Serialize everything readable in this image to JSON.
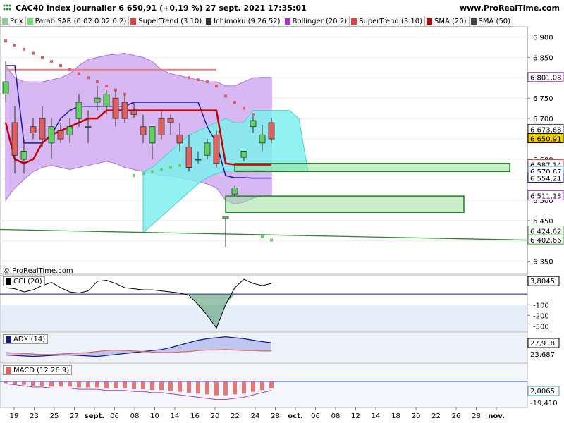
{
  "header": {
    "title": "CAC40 Index Journalier 6 650,91 (+0,19 %) 27 sept. 2021 17:35:01",
    "site": "www.ProRealTime.com",
    "copyright": "© ProRealTime.com"
  },
  "legend": [
    {
      "label": "Prix",
      "color": "#8fce8f"
    },
    {
      "label": "Parab SAR (0.02 0.02 0.2)",
      "color": "#6fe06f"
    },
    {
      "label": "SuperTrend (3 10)",
      "color": "#e04040"
    },
    {
      "label": "Ichimoku (9 26 52)",
      "color": "#303030"
    },
    {
      "label": "Bollinger (20 2)",
      "color": "#a040c0"
    },
    {
      "label": "SuperTrend (3 10)",
      "color": "#e04040"
    },
    {
      "label": "SMA (20)",
      "color": "#b00000"
    },
    {
      "label": "SMA (50)",
      "color": "#404040"
    }
  ],
  "colors": {
    "bull": "#5fd35f",
    "bear": "#e06060",
    "cloud": "#7feeee",
    "bollinger": "#c9a0ee",
    "sma20": "#cc0000",
    "kijun": "#1a1aa0",
    "sar": "#57d857",
    "sar_bear": "#e06060"
  },
  "chart_data": [
    {
      "type": "candlestick",
      "name": "Prix",
      "x_ticks": [
        "19",
        "23",
        "25",
        "27",
        "sept.",
        "06",
        "08",
        "10",
        "14",
        "16",
        "20",
        "22",
        "24",
        "28",
        "oct.",
        "06",
        "08",
        "12",
        "14",
        "18",
        "20",
        "22",
        "26",
        "28",
        "nov."
      ],
      "y_ticks": [
        6900,
        6850,
        6800,
        6750,
        6700,
        6650,
        6600,
        6550,
        6500,
        6450,
        6400,
        6350
      ],
      "y_tick_labels": [
        "6 900",
        "6 850",
        "6 800",
        "6 750",
        "6 700",
        "6 650",
        "6 600",
        "6 550",
        "6 500",
        "6 450",
        "6 400",
        "6 350"
      ],
      "ylim": [
        6320,
        6925
      ],
      "price_labels": [
        {
          "value": 6801.08,
          "label": "6 801,08",
          "color": "#a040c0"
        },
        {
          "value": 6673.68,
          "label": "6 673,68",
          "color": "#404040"
        },
        {
          "value": 6650.91,
          "label": "6 650,91",
          "color": "#000000",
          "highlight": "#f5d000"
        },
        {
          "value": 6587.14,
          "label": "6 587,14",
          "color": "#e04040"
        },
        {
          "value": 6570.67,
          "label": "6 570,67",
          "color": "#40a0c0"
        },
        {
          "value": 6554.21,
          "label": "6 554,21",
          "color": "#1a1aa0"
        },
        {
          "value": 6511.13,
          "label": "6 511,13",
          "color": "#a040c0"
        },
        {
          "value": 6424.62,
          "label": "6 424,62",
          "color": "#40a040"
        },
        {
          "value": 6402.66,
          "label": "6 402,66",
          "color": "#40a040"
        }
      ],
      "candles": [
        {
          "o": 6760,
          "h": 6840,
          "l": 6740,
          "c": 6790
        },
        {
          "o": 6690,
          "h": 6730,
          "l": 6565,
          "c": 6610
        },
        {
          "o": 6600,
          "h": 6650,
          "l": 6565,
          "c": 6620
        },
        {
          "o": 6680,
          "h": 6700,
          "l": 6650,
          "c": 6665
        },
        {
          "o": 6700,
          "h": 6730,
          "l": 6630,
          "c": 6650
        },
        {
          "o": 6640,
          "h": 6700,
          "l": 6600,
          "c": 6680
        },
        {
          "o": 6670,
          "h": 6690,
          "l": 6640,
          "c": 6650
        },
        {
          "o": 6660,
          "h": 6700,
          "l": 6640,
          "c": 6680
        },
        {
          "o": 6700,
          "h": 6760,
          "l": 6680,
          "c": 6740
        },
        {
          "o": 6680,
          "h": 6720,
          "l": 6640,
          "c": 6680
        },
        {
          "o": 6740,
          "h": 6780,
          "l": 6720,
          "c": 6750
        },
        {
          "o": 6730,
          "h": 6770,
          "l": 6710,
          "c": 6760
        },
        {
          "o": 6750,
          "h": 6770,
          "l": 6680,
          "c": 6700
        },
        {
          "o": 6740,
          "h": 6760,
          "l": 6690,
          "c": 6700
        },
        {
          "o": 6720,
          "h": 6740,
          "l": 6700,
          "c": 6710
        },
        {
          "o": 6680,
          "h": 6710,
          "l": 6640,
          "c": 6660
        },
        {
          "o": 6640,
          "h": 6670,
          "l": 6600,
          "c": 6680
        },
        {
          "o": 6700,
          "h": 6720,
          "l": 6650,
          "c": 6660
        },
        {
          "o": 6700,
          "h": 6710,
          "l": 6660,
          "c": 6690
        },
        {
          "o": 6660,
          "h": 6690,
          "l": 6620,
          "c": 6640
        },
        {
          "o": 6630,
          "h": 6660,
          "l": 6570,
          "c": 6580
        },
        {
          "o": 6600,
          "h": 6620,
          "l": 6590,
          "c": 6600
        },
        {
          "o": 6610,
          "h": 6650,
          "l": 6600,
          "c": 6640
        },
        {
          "o": 6660,
          "h": 6670,
          "l": 6580,
          "c": 6590
        },
        {
          "o": 6455,
          "h": 6460,
          "l": 6385,
          "c": 6460
        },
        {
          "o": 6515,
          "h": 6535,
          "l": 6510,
          "c": 6530
        },
        {
          "o": 6605,
          "h": 6620,
          "l": 6595,
          "c": 6620
        },
        {
          "o": 6680,
          "h": 6705,
          "l": 6665,
          "c": 6695
        },
        {
          "o": 6640,
          "h": 6685,
          "l": 6620,
          "c": 6660
        },
        {
          "o": 6690,
          "h": 6700,
          "l": 6640,
          "c": 6650
        }
      ],
      "supertrend": [
        6690,
        6600,
        6590,
        6600,
        6640,
        6660,
        6670,
        6680,
        6690,
        6700,
        6700,
        6720,
        6720,
        6720,
        6720,
        6720,
        6720,
        6720,
        6720,
        6720,
        6720,
        6720,
        6720,
        6720,
        6590,
        6587,
        6587,
        6587,
        6587,
        6587
      ],
      "supertrend_upper": [
        6820,
        6820,
        6820,
        6820,
        6820,
        6820,
        6820,
        6820,
        6820,
        6820,
        6820,
        6820,
        6820,
        6820,
        6820,
        6820,
        6820,
        6820,
        6820,
        6820,
        6820,
        6820,
        6820,
        6820,
        6820,
        6820,
        6820,
        6820,
        6820,
        6820
      ],
      "kijun": [
        6830,
        6830,
        6640,
        6640,
        6640,
        6660,
        6700,
        6720,
        6730,
        6730,
        6730,
        6730,
        6730,
        6730,
        6740,
        6740,
        6740,
        6740,
        6740,
        6740,
        6740,
        6740,
        6680,
        6640,
        6560,
        6555,
        6555,
        6554,
        6554,
        6554
      ],
      "boll_upper": [
        6830,
        6800,
        6790,
        6790,
        6790,
        6795,
        6800,
        6810,
        6830,
        6845,
        6850,
        6855,
        6858,
        6860,
        6855,
        6850,
        6840,
        6820,
        6810,
        6805,
        6800,
        6795,
        6790,
        6790,
        6780,
        6780,
        6790,
        6800,
        6801,
        6801
      ],
      "boll_lower": [
        6500,
        6530,
        6550,
        6570,
        6580,
        6585,
        6580,
        6575,
        6580,
        6585,
        6590,
        6595,
        6590,
        6580,
        6575,
        6570,
        6565,
        6560,
        6560,
        6555,
        6550,
        6545,
        6540,
        6530,
        6500,
        6490,
        6495,
        6505,
        6510,
        6511
      ],
      "sar": [
        6890,
        6880,
        6870,
        6860,
        6850,
        6840,
        6830,
        6820,
        6810,
        6800,
        6790,
        6780,
        6770,
        6760,
        6560,
        6565,
        6570,
        6575,
        6580,
        6585,
        6800,
        6795,
        6790,
        6780,
        6755,
        6740,
        6725,
        6710,
        6410,
        6402
      ],
      "ichimoku_cloud": {
        "upper": [
          6570,
          6580,
          6600,
          6620,
          6640,
          6660,
          6670,
          6680,
          6690,
          6700,
          6690,
          6690,
          6720,
          6720,
          6720,
          6720,
          6720,
          6700,
          6570
        ],
        "lower": [
          6420,
          6440,
          6460,
          6480,
          6500,
          6520,
          6540,
          6555,
          6565,
          6570,
          6572,
          6574,
          6574,
          6573,
          6572,
          6571,
          6570,
          6570,
          6570
        ]
      },
      "zones": [
        {
          "from": 6570,
          "to": 6590,
          "start": 25,
          "end": 55
        },
        {
          "from": 6470,
          "to": 6510,
          "start": 24,
          "end": 50
        }
      ],
      "support_line": {
        "start": 6428,
        "end": 6402
      }
    },
    {
      "type": "line",
      "name": "CCI (20)",
      "label": "CCI (20)",
      "last_label": "3,8045",
      "y_tick_labels": [
        "-100",
        "-200",
        "-300"
      ],
      "ylim": [
        -350,
        180
      ],
      "values": [
        60,
        50,
        20,
        40,
        80,
        110,
        60,
        20,
        10,
        30,
        120,
        130,
        100,
        60,
        50,
        40,
        40,
        30,
        20,
        10,
        -10,
        -100,
        -200,
        -320,
        -100,
        60,
        140,
        100,
        80,
        100
      ],
      "baseline": 0
    },
    {
      "type": "area",
      "name": "ADX (14)",
      "label": "ADX (14)",
      "last_labels": [
        "27,918",
        "23,687"
      ],
      "plus": [
        15,
        14,
        13,
        12,
        13,
        14,
        15,
        15,
        14,
        13,
        12,
        14,
        16,
        18,
        20,
        22,
        24,
        26,
        30,
        35,
        40,
        45,
        48,
        50,
        52,
        50,
        48,
        45,
        42,
        40
      ],
      "minus": [
        20,
        19,
        18,
        17,
        16,
        16,
        17,
        18,
        19,
        20,
        22,
        24,
        25,
        24,
        23,
        22,
        21,
        20,
        20,
        21,
        22,
        24,
        25,
        25,
        26,
        25,
        24,
        24,
        23,
        23
      ],
      "ylim": [
        0,
        60
      ]
    },
    {
      "type": "histogram",
      "name": "MACD (12 26 9)",
      "label": "MACD (12 26 9)",
      "last_labels": [
        "2,0065",
        "-19,410"
      ],
      "values": [
        -2,
        -3,
        -4,
        -5,
        -5,
        -6,
        -6,
        -6,
        -7,
        -7,
        -7,
        -8,
        -8,
        -8,
        -9,
        -9,
        -10,
        -10,
        -11,
        -12,
        -13,
        -14,
        -15,
        -16,
        -16,
        -15,
        -14,
        -12,
        -10,
        -8
      ],
      "ylim": [
        -30,
        20
      ]
    }
  ]
}
